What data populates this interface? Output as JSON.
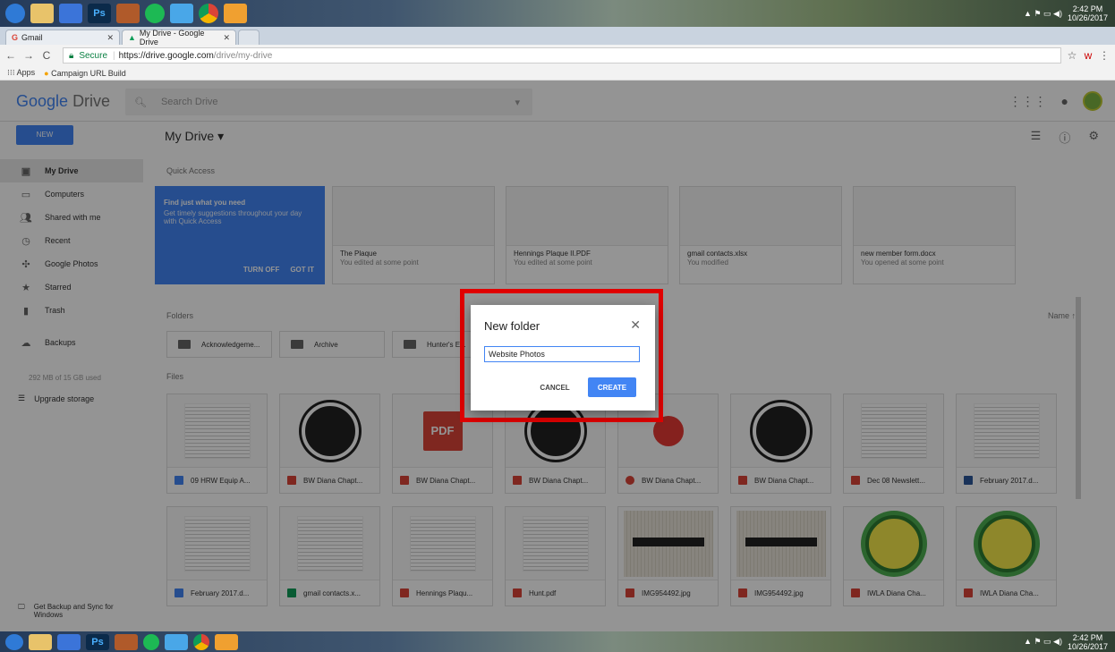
{
  "taskbar": {
    "clock_time": "2:42 PM",
    "clock_date": "10/26/2017",
    "apps": [
      "windows-start-icon",
      "file-explorer-icon",
      "dropbox-icon",
      "photoshop-icon",
      "misc-app-icon",
      "spotify-icon",
      "ie-icon",
      "chrome-icon",
      "outlook-icon"
    ],
    "app_labels": {
      "photoshop": "Ps"
    }
  },
  "browser": {
    "tabs": [
      {
        "label": "Gmail",
        "active": false
      },
      {
        "label": "My Drive - Google Drive",
        "active": true
      }
    ],
    "url_secure_label": "Secure",
    "url_host": "https://drive.google.com",
    "url_path": "/drive/my-drive",
    "bookmarks": [
      "Apps",
      "Campaign URL Build"
    ]
  },
  "drive": {
    "logo_google": "Google",
    "logo_drive": "Drive",
    "search_placeholder": "Search Drive",
    "new_button": "NEW",
    "page_title": "My Drive",
    "sidebar": [
      {
        "label": "My Drive",
        "icon": "drive-icon",
        "active": true
      },
      {
        "label": "Computers",
        "icon": "computer-icon"
      },
      {
        "label": "Shared with me",
        "icon": "people-icon"
      },
      {
        "label": "Recent",
        "icon": "clock-icon"
      },
      {
        "label": "Google Photos",
        "icon": "photos-icon"
      },
      {
        "label": "Starred",
        "icon": "star-icon"
      },
      {
        "label": "Trash",
        "icon": "trash-icon"
      },
      {
        "label": "Backups",
        "icon": "cloud-icon"
      }
    ],
    "storage_text": "292 MB of 15 GB used",
    "upgrade_label": "Upgrade storage",
    "backup_sync_label": "Get Backup and Sync for Windows",
    "quick_access_label": "Quick Access",
    "promo": {
      "title": "Find just what you need",
      "desc": "Get timely suggestions throughout your day with Quick Access",
      "turn_off": "TURN OFF",
      "got_it": "GOT IT"
    },
    "quick_access": [
      {
        "name": "The Plaque",
        "sub": "You edited at some point"
      },
      {
        "name": "Hennings Plaque II.PDF",
        "sub": "You edited at some point"
      },
      {
        "name": "gmail contacts.xlsx",
        "sub": "You modified"
      },
      {
        "name": "new member form.docx",
        "sub": "You opened at some point"
      }
    ],
    "folders_label": "Folders",
    "sort_label": "Name",
    "folders": [
      "Acknowledgeme...",
      "Archive",
      "Hunter's E..."
    ],
    "files_label": "Files",
    "files_row1": [
      {
        "name": "09 HRW Equip A...",
        "type": "doc"
      },
      {
        "name": "BW Diana Chapt...",
        "type": "img"
      },
      {
        "name": "BW Diana Chapt...",
        "type": "pdf"
      },
      {
        "name": "BW Diana Chapt...",
        "type": "img"
      },
      {
        "name": "BW Diana Chapt...",
        "type": "drawing"
      },
      {
        "name": "BW Diana Chapt...",
        "type": "img"
      },
      {
        "name": "Dec 08 Newslett...",
        "type": "pdf"
      },
      {
        "name": "February 2017.d...",
        "type": "word"
      }
    ],
    "files_row2": [
      {
        "name": "February 2017.d...",
        "type": "doc"
      },
      {
        "name": "gmail contacts.x...",
        "type": "xls"
      },
      {
        "name": "Hennings Plaqu...",
        "type": "pdf"
      },
      {
        "name": "Hunt.pdf",
        "type": "pdf"
      },
      {
        "name": "IMG954492.jpg",
        "type": "img"
      },
      {
        "name": "IMG954492.jpg",
        "type": "img"
      },
      {
        "name": "IWLA Diana Cha...",
        "type": "img"
      },
      {
        "name": "IWLA Diana Cha...",
        "type": "img"
      }
    ]
  },
  "dialog": {
    "title": "New folder",
    "input_value": "Website Photos",
    "cancel_label": "CANCEL",
    "create_label": "CREATE"
  }
}
